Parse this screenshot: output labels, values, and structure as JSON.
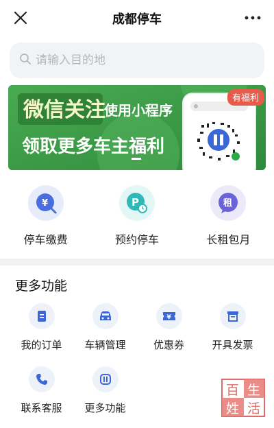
{
  "header": {
    "title": "成都停车"
  },
  "search": {
    "placeholder": "请输入目的地"
  },
  "banner": {
    "line1": "微信关注",
    "line1b": "使用小程序",
    "line2": "领取更多车主福利",
    "badge": "有福利"
  },
  "quick": [
    {
      "label": "停车缴费",
      "icon": "parking-fee-icon",
      "color": "#4a6ee0"
    },
    {
      "label": "预约停车",
      "icon": "reserve-parking-icon",
      "color": "#2fb8b8"
    },
    {
      "label": "长租包月",
      "icon": "monthly-rent-icon",
      "color": "#6a62d8"
    }
  ],
  "quick_glyphs": {
    "fee": "¥",
    "reserve": "P",
    "rent": "租"
  },
  "more": {
    "title": "更多功能",
    "items": [
      {
        "label": "我的订单",
        "icon": "order-icon"
      },
      {
        "label": "车辆管理",
        "icon": "car-icon"
      },
      {
        "label": "优惠券",
        "icon": "coupon-icon"
      },
      {
        "label": "开具发票",
        "icon": "invoice-icon"
      },
      {
        "label": "联系客服",
        "icon": "phone-icon"
      },
      {
        "label": "更多功能",
        "icon": "more-apps-icon"
      }
    ]
  },
  "watermark": {
    "chars": [
      "百",
      "生",
      "姓",
      "活"
    ]
  }
}
